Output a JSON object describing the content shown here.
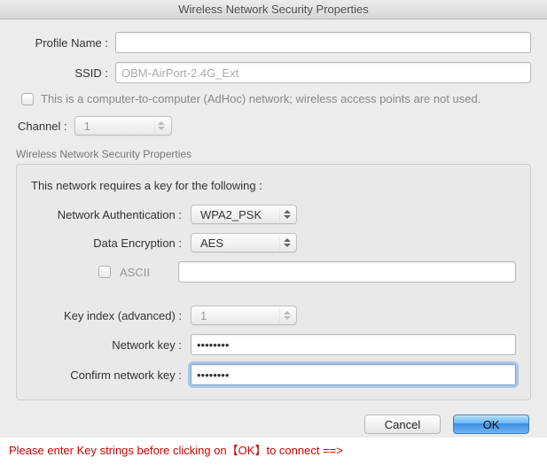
{
  "window": {
    "title": "Wireless Network Security Properties"
  },
  "top": {
    "profile_label": "Profile Name :",
    "profile_value": "",
    "ssid_label": "SSID :",
    "ssid_placeholder": "OBM-AirPort-2.4G_Ext",
    "ssid_value": "",
    "adhoc_text": "This is a computer-to-computer (AdHoc) network; wireless access points are not used.",
    "channel_label": "Channel :",
    "channel_value": "1"
  },
  "group": {
    "legend": "Wireless Network Security Properties",
    "heading": "This network requires a key for the following :",
    "auth_label": "Network Authentication :",
    "auth_value": "WPA2_PSK",
    "enc_label": "Data Encryption :",
    "enc_value": "AES",
    "ascii_label": "ASCII",
    "keyindex_label": "Key index (advanced) :",
    "keyindex_value": "1",
    "netkey_label": "Network key :",
    "netkey_value": "••••••••",
    "confkey_label": "Confirm network key :",
    "confkey_value": "••••••••"
  },
  "buttons": {
    "cancel": "Cancel",
    "ok": "OK"
  },
  "hint": "Please enter Key strings before clicking on【OK】to connect ==>"
}
